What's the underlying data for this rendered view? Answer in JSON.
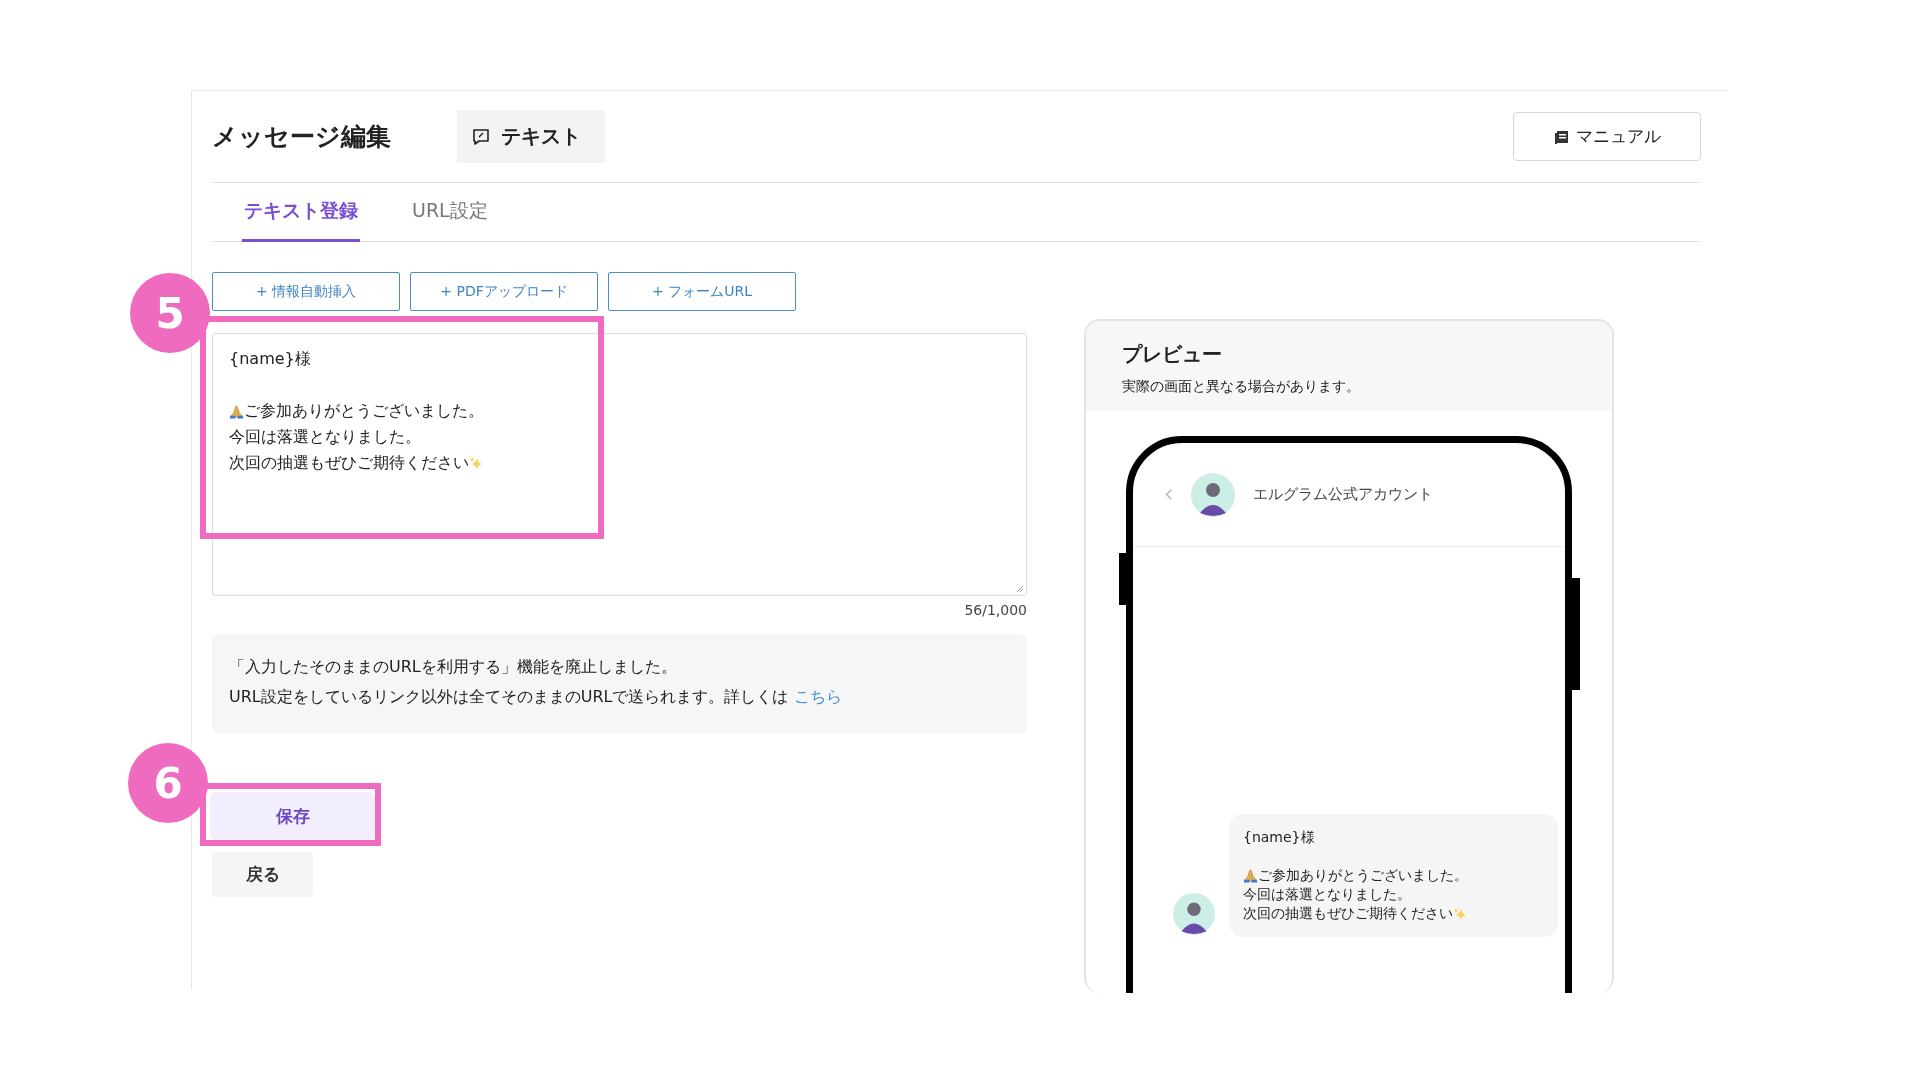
{
  "header": {
    "title": "メッセージ編集",
    "type_tag": "テキスト",
    "manual_button": "マニュアル"
  },
  "tabs": [
    {
      "label": "テキスト登録",
      "selected": true
    },
    {
      "label": "URL設定",
      "selected": false
    }
  ],
  "insert_buttons": [
    "+ 情報自動挿入",
    "+ PDFアップロード",
    "+ フォームURL"
  ],
  "editor": {
    "lines": [
      {
        "kind": "plain",
        "text": "{name}様"
      },
      {
        "kind": "blank"
      },
      {
        "kind": "lead-emoji",
        "text": "ご参加ありがとうございました。"
      },
      {
        "kind": "plain",
        "text": "今回は落選となりました。"
      },
      {
        "kind": "trail-emoji",
        "text": "次回の抽選もぜひご期待ください"
      }
    ],
    "char_count": "56/1,000"
  },
  "notice": {
    "line_1": "「入力したそのままのURLを利用する」機能を廃止しました。",
    "line_2": "URL設定をしているリンク以外は全てそのままのURLで送られます。詳しくは",
    "link": "こちら"
  },
  "save_button": "保存",
  "back_button": "戻る",
  "annotations": [
    "5",
    "6"
  ],
  "preview": {
    "title": "プレビュー",
    "subtitle": "実際の画面と異なる場合があります。",
    "account_name": "エルグラム公式アカウント",
    "bubble_lines": [
      {
        "kind": "plain",
        "text": "{name}様"
      },
      {
        "kind": "blank"
      },
      {
        "kind": "lead-emoji",
        "text": "ご参加ありがとうございました。"
      },
      {
        "kind": "plain",
        "text": "今回は落選となりました。"
      },
      {
        "kind": "trail-emoji",
        "text": "次回の抽選もぜひご期待ください"
      }
    ]
  }
}
